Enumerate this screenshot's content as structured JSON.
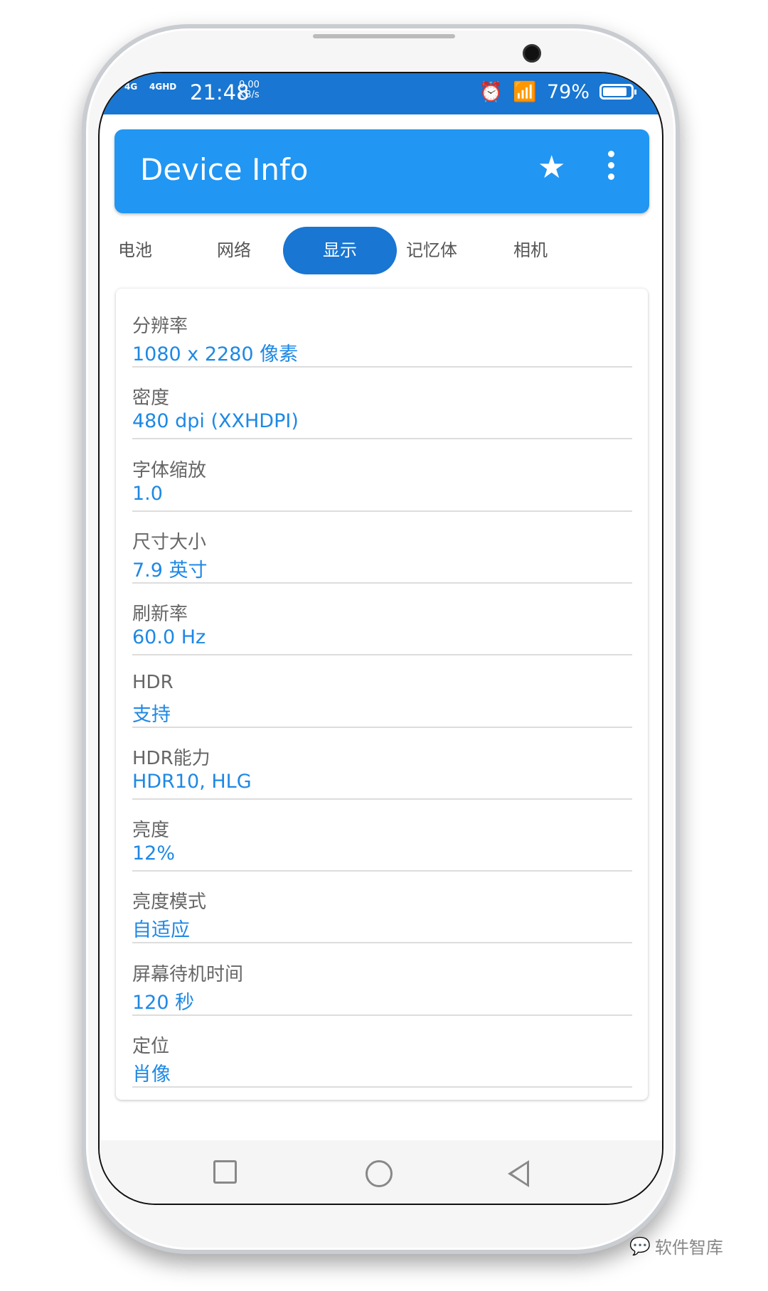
{
  "status_bar": {
    "signal1": "4G",
    "signal2": "4GHD",
    "time": "21:48",
    "speed_value": "0.00",
    "speed_unit": "KB/s",
    "battery": "79%",
    "battery_level": 0.79
  },
  "app_bar": {
    "title": "Device Info",
    "icons": [
      "star-icon",
      "more-vert-icon"
    ]
  },
  "tabs": [
    {
      "label": "电池"
    },
    {
      "label": "网络"
    },
    {
      "label": "显示",
      "active": true
    },
    {
      "label": "记忆体"
    },
    {
      "label": "相机"
    }
  ],
  "rows": [
    {
      "label": "分辨率",
      "value": "1080 x 2280 像素"
    },
    {
      "label": "密度",
      "value": "480 dpi (XXHDPI)"
    },
    {
      "label": "字体缩放",
      "value": "1.0"
    },
    {
      "label": "尺寸大小",
      "value": "7.9 英寸"
    },
    {
      "label": "刷新率",
      "value": "60.0 Hz"
    },
    {
      "label": "HDR",
      "value": "支持"
    },
    {
      "label": "HDR能力",
      "value": "HDR10, HLG"
    },
    {
      "label": "亮度",
      "value": "12%"
    },
    {
      "label": "亮度模式",
      "value": "自适应"
    },
    {
      "label": "屏幕待机时间",
      "value": "120 秒"
    },
    {
      "label": "定位",
      "value": "肖像"
    }
  ],
  "watermark": "软件智库",
  "colors": {
    "status_bar": "#1976d2",
    "app_bar": "#2196f3",
    "active_tab": "#1976d2",
    "value_text": "#1e88e5"
  }
}
